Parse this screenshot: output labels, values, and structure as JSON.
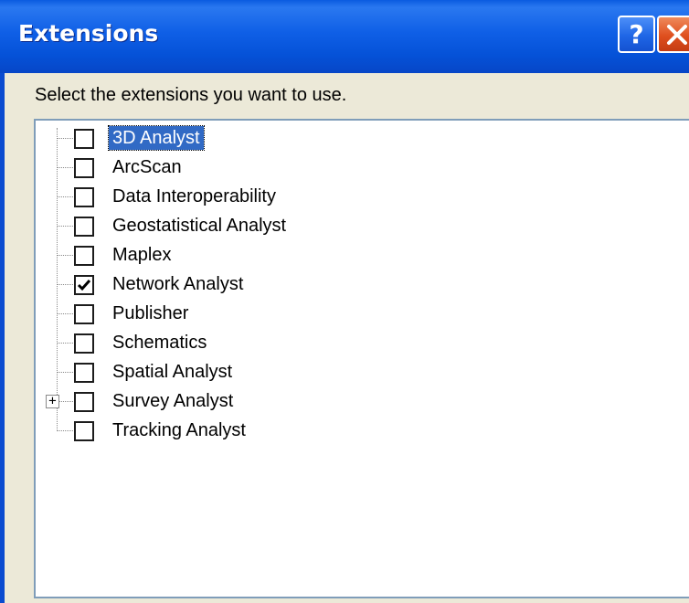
{
  "window": {
    "title": "Extensions",
    "help_glyph": "?",
    "close_icon": "close-icon"
  },
  "prompt": "Select the extensions you want to use.",
  "extensions": [
    {
      "label": "3D Analyst",
      "checked": false,
      "selected": true
    },
    {
      "label": "ArcScan",
      "checked": false
    },
    {
      "label": "Data Interoperability",
      "checked": false
    },
    {
      "label": "Geostatistical Analyst",
      "checked": false
    },
    {
      "label": "Maplex",
      "checked": false
    },
    {
      "label": "Network Analyst",
      "checked": true
    },
    {
      "label": "Publisher",
      "checked": false
    },
    {
      "label": "Schematics",
      "checked": false
    },
    {
      "label": "Spatial Analyst",
      "checked": false
    },
    {
      "label": "Survey Analyst",
      "checked": false,
      "expandable": true,
      "expander_glyph": "+"
    },
    {
      "label": "Tracking Analyst",
      "checked": false
    }
  ],
  "colors": {
    "titlebar": "#0552d8",
    "selection": "#316ac5",
    "close_button": "#df4f1e"
  }
}
